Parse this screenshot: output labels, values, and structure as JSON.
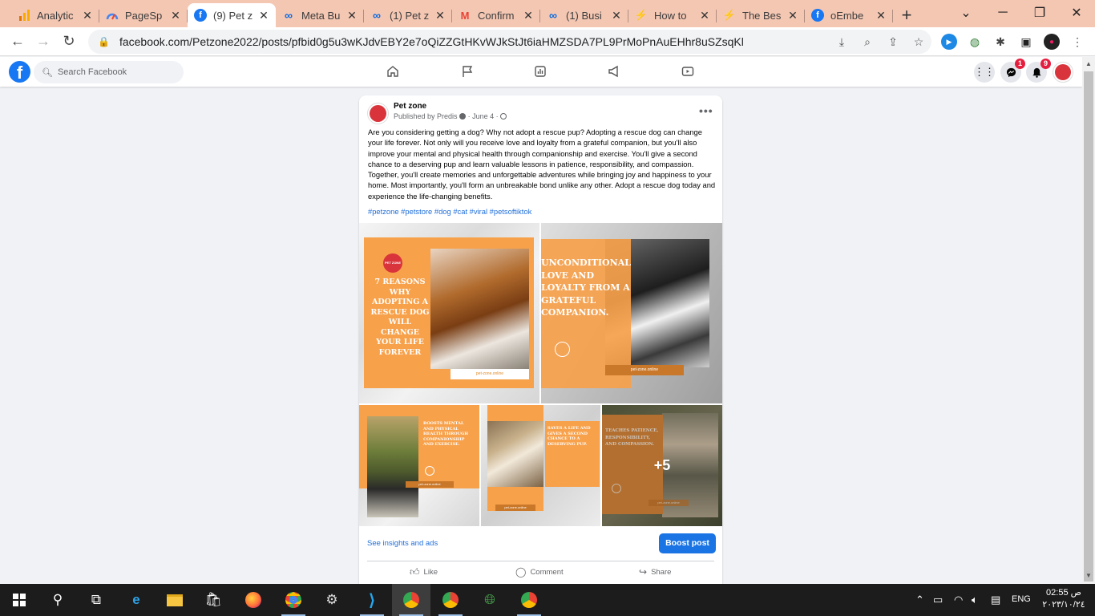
{
  "browser": {
    "tabs": [
      {
        "title": "Analytic",
        "icon": "analytics-icon",
        "color": "#f9ab00"
      },
      {
        "title": "PageSp",
        "icon": "pagespeed-icon",
        "color": "#4285f4"
      },
      {
        "title": "(9) Pet z",
        "icon": "facebook-icon",
        "color": "#1877f2"
      },
      {
        "title": "Meta Bu",
        "icon": "meta-icon",
        "color": "#0668e1"
      },
      {
        "title": "(1) Pet z",
        "icon": "meta-icon",
        "color": "#0668e1"
      },
      {
        "title": "Confirm",
        "icon": "gmail-icon",
        "color": "#ea4335"
      },
      {
        "title": "(1) Busi",
        "icon": "meta-icon",
        "color": "#0668e1"
      },
      {
        "title": "How to",
        "icon": "bolt-icon",
        "color": "#333333"
      },
      {
        "title": "The Bes",
        "icon": "bolt-icon",
        "color": "#333333"
      },
      {
        "title": "oEmbe",
        "icon": "facebook-icon",
        "color": "#1877f2"
      }
    ],
    "new_tab_label": "+",
    "url": "facebook.com/Petzone2022/posts/pfbid0g5u3wKJdvEBY2e7oQiZZGtHKvWJkStJt6iaHMZSDA7PL9PrMoPnAuEHhr8uSZsqKl"
  },
  "facebook": {
    "search_placeholder": "Search Facebook",
    "messenger_badge": "1",
    "notifications_badge": "9",
    "accent": "#1877f2"
  },
  "post": {
    "page_name": "Pet zone",
    "published_by": "Published by Predis",
    "separator": "·",
    "date": "June 4",
    "body": "Are you considering getting a dog? Why not adopt a rescue pup? Adopting a rescue dog can change your life forever. Not only will you receive love and loyalty from a grateful companion, but you'll also improve your mental and physical health through companionship and exercise. You'll give a second chance to a deserving pup and learn valuable lessons in patience, responsibility, and compassion. Together, you'll create memories and unforgettable adventures while bringing joy and happiness to your home. Most importantly, you'll form an unbreakable bond unlike any other. Adopt a rescue dog today and experience the life-changing benefits.",
    "hashtags": "#petzone #petstore #dog #cat #viral #petsoftiktok",
    "images": [
      {
        "text": "7 REASONS WHY ADOPTING A RESCUE DOG WILL CHANGE YOUR LIFE FOREVER",
        "url": "pet-zone.online",
        "logo": "PET ZONE"
      },
      {
        "text": "UNCONDITIONAL LOVE AND LOYALTY FROM A GRATEFUL COMPANION.",
        "url": "pet-zone.online",
        "number": "1"
      },
      {
        "text": "BOOSTS MENTAL AND PHYSICAL HEALTH THROUGH COMPANIONSHIP AND EXERCISE.",
        "url": "pet-zone.online",
        "number": "2"
      },
      {
        "text": "SAVES A LIFE AND GIVES A SECOND CHANCE TO A DESERVING PUP.",
        "url": "pet-zone.online"
      },
      {
        "text": "TEACHES PATIENCE, RESPONSIBILITY, AND COMPASSION.",
        "url": "pet-zone.online",
        "more": "+5"
      }
    ],
    "insights_link": "See insights and ads",
    "boost_label": "Boost post",
    "actions": {
      "like": "Like",
      "comment": "Comment",
      "share": "Share"
    },
    "orange": "#f7a14b"
  },
  "taskbar": {
    "language": "ENG",
    "time": "02:55 ص",
    "date": "٢٠٢٣/١٠/٢٤"
  }
}
